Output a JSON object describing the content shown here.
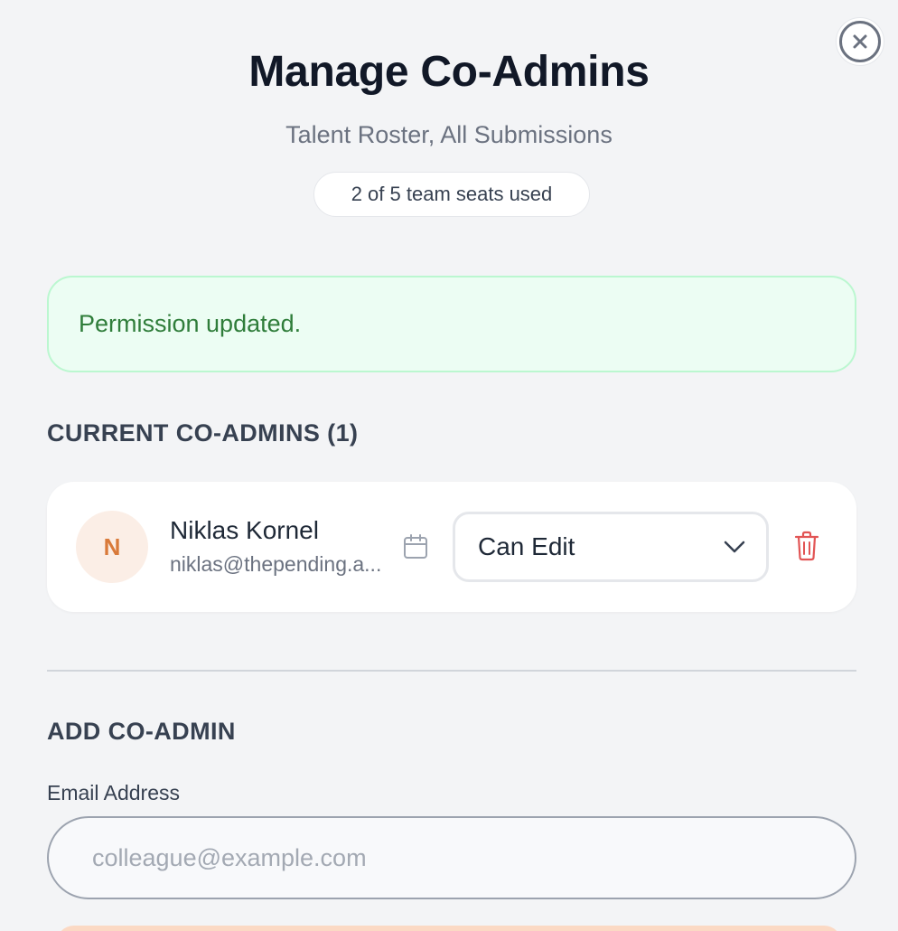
{
  "header": {
    "title": "Manage Co-Admins",
    "subtitle": "Talent Roster, All Submissions",
    "seats_label": "2 of 5 team seats used"
  },
  "alert": {
    "message": "Permission updated."
  },
  "current_admins": {
    "heading": "CURRENT CO-ADMINS (1)",
    "items": [
      {
        "initial": "N",
        "name": "Niklas Kornel",
        "email": "niklas@thepending.a...",
        "permission": "Can Edit"
      }
    ]
  },
  "add_admin": {
    "heading": "ADD CO-ADMIN",
    "email_label": "Email Address",
    "email_placeholder": "colleague@example.com",
    "email_value": ""
  },
  "icons": {
    "close": "close-icon",
    "calendar": "calendar-icon",
    "dropdown": "chevron-down-icon",
    "delete": "trash-icon"
  },
  "colors": {
    "background": "#f3f4f6",
    "success_bg": "#ecfdf3",
    "success_text": "#2f7d3a",
    "avatar_bg": "#fbeee6",
    "avatar_text": "#d97a3a",
    "danger": "#e25555"
  }
}
